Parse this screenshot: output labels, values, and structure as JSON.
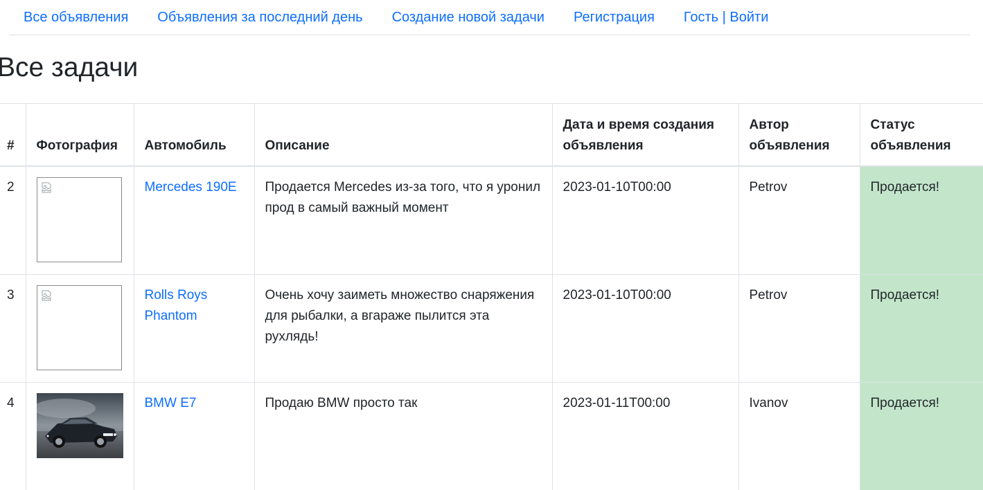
{
  "nav": {
    "items": [
      {
        "label": "Все объявления"
      },
      {
        "label": "Объявления за последний день"
      },
      {
        "label": "Создание новой задачи"
      },
      {
        "label": "Регистрация"
      },
      {
        "label": "Гость | Войти"
      }
    ]
  },
  "page": {
    "title": "Все задачи"
  },
  "table": {
    "headers": [
      "#",
      "Фотография",
      "Автомобиль",
      "Описание",
      "Дата и время создания объявления",
      "Автор объявления",
      "Статус объявления"
    ],
    "rows": [
      {
        "id": "2",
        "photo": "broken-image-icon",
        "car": "Mercedes 190E",
        "description": "Продается Mercedes из-за того, что я уронил прод в самый важный момент",
        "created": "2023-01-10T00:00",
        "author": "Petrov",
        "status": "Продается!"
      },
      {
        "id": "3",
        "photo": "broken-image-icon",
        "car": "Rolls Roys Phantom",
        "description": "Очень хочу заиметь множество снаряжения для рыбалки, а вгараже пылится эта рухлядь!",
        "created": "2023-01-10T00:00",
        "author": "Petrov",
        "status": "Продается!"
      },
      {
        "id": "4",
        "photo": "car-photo",
        "car": "BMW E7",
        "description": "Продаю BMW просто так",
        "created": "2023-01-11T00:00",
        "author": "Ivanov",
        "status": "Продается!"
      }
    ]
  },
  "colors": {
    "link": "#0d6efd",
    "status_bg": "#c3e6cb"
  }
}
